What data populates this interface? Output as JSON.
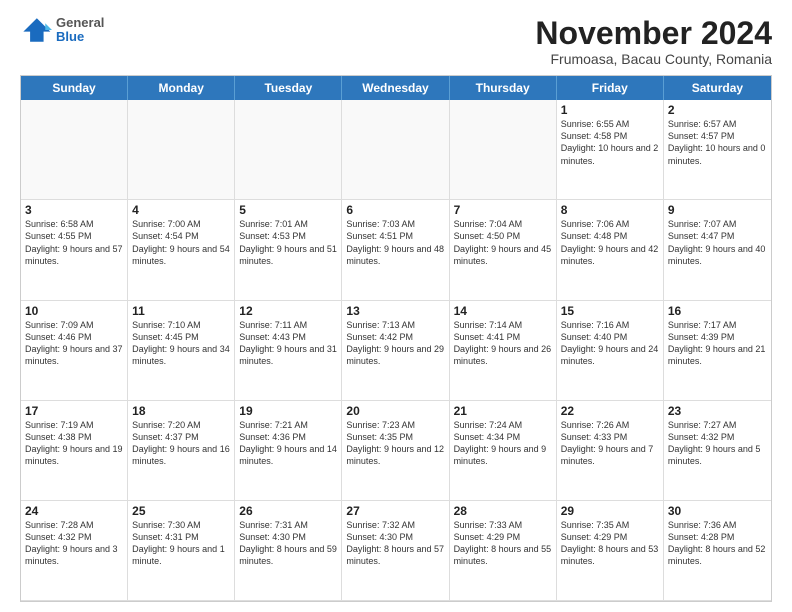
{
  "header": {
    "logo": {
      "general": "General",
      "blue": "Blue"
    },
    "title": "November 2024",
    "subtitle": "Frumoasa, Bacau County, Romania"
  },
  "calendar": {
    "days_of_week": [
      "Sunday",
      "Monday",
      "Tuesday",
      "Wednesday",
      "Thursday",
      "Friday",
      "Saturday"
    ],
    "weeks": [
      [
        {
          "day": "",
          "info": "",
          "empty": true
        },
        {
          "day": "",
          "info": "",
          "empty": true
        },
        {
          "day": "",
          "info": "",
          "empty": true
        },
        {
          "day": "",
          "info": "",
          "empty": true
        },
        {
          "day": "",
          "info": "",
          "empty": true
        },
        {
          "day": "1",
          "info": "Sunrise: 6:55 AM\nSunset: 4:58 PM\nDaylight: 10 hours\nand 2 minutes."
        },
        {
          "day": "2",
          "info": "Sunrise: 6:57 AM\nSunset: 4:57 PM\nDaylight: 10 hours\nand 0 minutes."
        }
      ],
      [
        {
          "day": "3",
          "info": "Sunrise: 6:58 AM\nSunset: 4:55 PM\nDaylight: 9 hours\nand 57 minutes."
        },
        {
          "day": "4",
          "info": "Sunrise: 7:00 AM\nSunset: 4:54 PM\nDaylight: 9 hours\nand 54 minutes."
        },
        {
          "day": "5",
          "info": "Sunrise: 7:01 AM\nSunset: 4:53 PM\nDaylight: 9 hours\nand 51 minutes."
        },
        {
          "day": "6",
          "info": "Sunrise: 7:03 AM\nSunset: 4:51 PM\nDaylight: 9 hours\nand 48 minutes."
        },
        {
          "day": "7",
          "info": "Sunrise: 7:04 AM\nSunset: 4:50 PM\nDaylight: 9 hours\nand 45 minutes."
        },
        {
          "day": "8",
          "info": "Sunrise: 7:06 AM\nSunset: 4:48 PM\nDaylight: 9 hours\nand 42 minutes."
        },
        {
          "day": "9",
          "info": "Sunrise: 7:07 AM\nSunset: 4:47 PM\nDaylight: 9 hours\nand 40 minutes."
        }
      ],
      [
        {
          "day": "10",
          "info": "Sunrise: 7:09 AM\nSunset: 4:46 PM\nDaylight: 9 hours\nand 37 minutes."
        },
        {
          "day": "11",
          "info": "Sunrise: 7:10 AM\nSunset: 4:45 PM\nDaylight: 9 hours\nand 34 minutes."
        },
        {
          "day": "12",
          "info": "Sunrise: 7:11 AM\nSunset: 4:43 PM\nDaylight: 9 hours\nand 31 minutes."
        },
        {
          "day": "13",
          "info": "Sunrise: 7:13 AM\nSunset: 4:42 PM\nDaylight: 9 hours\nand 29 minutes."
        },
        {
          "day": "14",
          "info": "Sunrise: 7:14 AM\nSunset: 4:41 PM\nDaylight: 9 hours\nand 26 minutes."
        },
        {
          "day": "15",
          "info": "Sunrise: 7:16 AM\nSunset: 4:40 PM\nDaylight: 9 hours\nand 24 minutes."
        },
        {
          "day": "16",
          "info": "Sunrise: 7:17 AM\nSunset: 4:39 PM\nDaylight: 9 hours\nand 21 minutes."
        }
      ],
      [
        {
          "day": "17",
          "info": "Sunrise: 7:19 AM\nSunset: 4:38 PM\nDaylight: 9 hours\nand 19 minutes."
        },
        {
          "day": "18",
          "info": "Sunrise: 7:20 AM\nSunset: 4:37 PM\nDaylight: 9 hours\nand 16 minutes."
        },
        {
          "day": "19",
          "info": "Sunrise: 7:21 AM\nSunset: 4:36 PM\nDaylight: 9 hours\nand 14 minutes."
        },
        {
          "day": "20",
          "info": "Sunrise: 7:23 AM\nSunset: 4:35 PM\nDaylight: 9 hours\nand 12 minutes."
        },
        {
          "day": "21",
          "info": "Sunrise: 7:24 AM\nSunset: 4:34 PM\nDaylight: 9 hours\nand 9 minutes."
        },
        {
          "day": "22",
          "info": "Sunrise: 7:26 AM\nSunset: 4:33 PM\nDaylight: 9 hours\nand 7 minutes."
        },
        {
          "day": "23",
          "info": "Sunrise: 7:27 AM\nSunset: 4:32 PM\nDaylight: 9 hours\nand 5 minutes."
        }
      ],
      [
        {
          "day": "24",
          "info": "Sunrise: 7:28 AM\nSunset: 4:32 PM\nDaylight: 9 hours\nand 3 minutes."
        },
        {
          "day": "25",
          "info": "Sunrise: 7:30 AM\nSunset: 4:31 PM\nDaylight: 9 hours\nand 1 minute."
        },
        {
          "day": "26",
          "info": "Sunrise: 7:31 AM\nSunset: 4:30 PM\nDaylight: 8 hours\nand 59 minutes."
        },
        {
          "day": "27",
          "info": "Sunrise: 7:32 AM\nSunset: 4:30 PM\nDaylight: 8 hours\nand 57 minutes."
        },
        {
          "day": "28",
          "info": "Sunrise: 7:33 AM\nSunset: 4:29 PM\nDaylight: 8 hours\nand 55 minutes."
        },
        {
          "day": "29",
          "info": "Sunrise: 7:35 AM\nSunset: 4:29 PM\nDaylight: 8 hours\nand 53 minutes."
        },
        {
          "day": "30",
          "info": "Sunrise: 7:36 AM\nSunset: 4:28 PM\nDaylight: 8 hours\nand 52 minutes."
        }
      ]
    ]
  }
}
